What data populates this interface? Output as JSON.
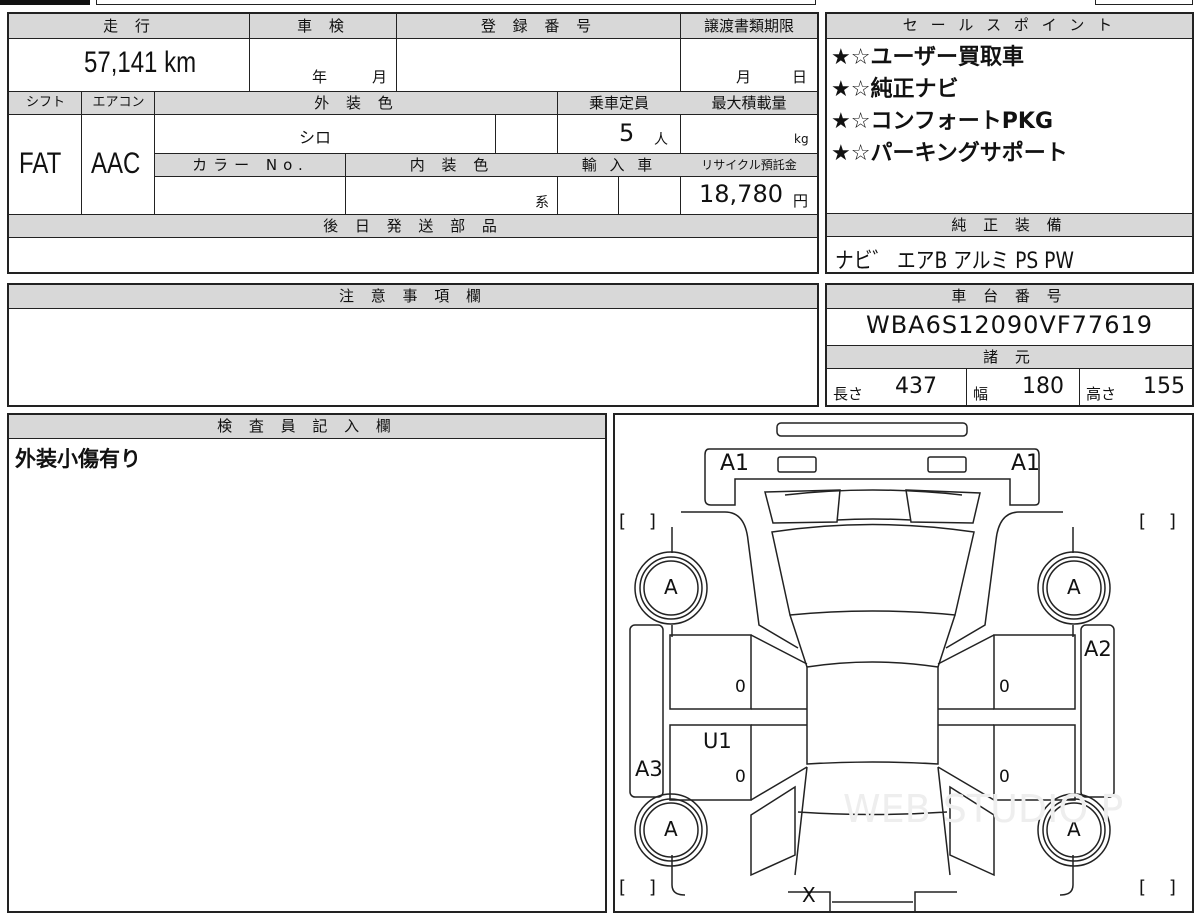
{
  "main_table": {
    "mileage_label": "走 行",
    "mileage": "57,141 km",
    "inspection_label": "車 検",
    "inspection_year": "年",
    "inspection_month": "月",
    "registration_label": "登 録 番 号",
    "registration_value": "",
    "transfer_label": "譲渡書類期限",
    "transfer_month": "月",
    "transfer_day": "日",
    "shift_label": "シフト",
    "shift": "FAT",
    "ac_label": "エアコン",
    "ac": "AAC",
    "exterior_label": "外 装 色",
    "exterior": "シロ",
    "capacity_label": "乗車定員",
    "capacity": "5",
    "capacity_unit": "人",
    "load_label": "最大積載量",
    "load_unit": "kg",
    "colorno_label": "カラー No.",
    "interior_label": "内 装 色",
    "interior_unit": "系",
    "import_label": "輸 入 車",
    "recycle_label": "リサイクル預託金",
    "recycle": "18,780",
    "recycle_unit": "円",
    "parts_label": "後 日 発 送 部 品",
    "parts": ""
  },
  "notes": {
    "label": "注 意 事 項 欄",
    "value": ""
  },
  "inspector": {
    "label": "検 査 員 記 入 欄",
    "value": "外装小傷有り"
  },
  "sales_points": {
    "label": "セ ー ル ス ポ イ ン ト",
    "items": [
      "★☆ユーザー買取車",
      "★☆純正ナビ",
      "★☆コンフォートPKG",
      "★☆パーキングサポート"
    ]
  },
  "equipment": {
    "label": "純 正 装 備",
    "value": "ナビ゛ エアB アルミ PS PW"
  },
  "chassis": {
    "label": "車 台 番 号",
    "value": "WBA6S12090VF77619"
  },
  "specs": {
    "label": "諸 元",
    "length_label": "長さ",
    "length": "437",
    "width_label": "幅",
    "width": "180",
    "height_label": "高さ",
    "height": "155"
  },
  "diagram": {
    "a1_left": "A1",
    "a1_right": "A1",
    "wheel_fl": "A",
    "wheel_fr": "A",
    "wheel_rl": "A",
    "wheel_rr": "A",
    "a2": "A2",
    "a3": "A3",
    "u1": "U1",
    "zero1": "0",
    "zero2": "0",
    "zero3": "0",
    "zero4": "0",
    "x": "X",
    "bracket": "[    ]",
    "watermark": "WEB STUDIO P"
  }
}
